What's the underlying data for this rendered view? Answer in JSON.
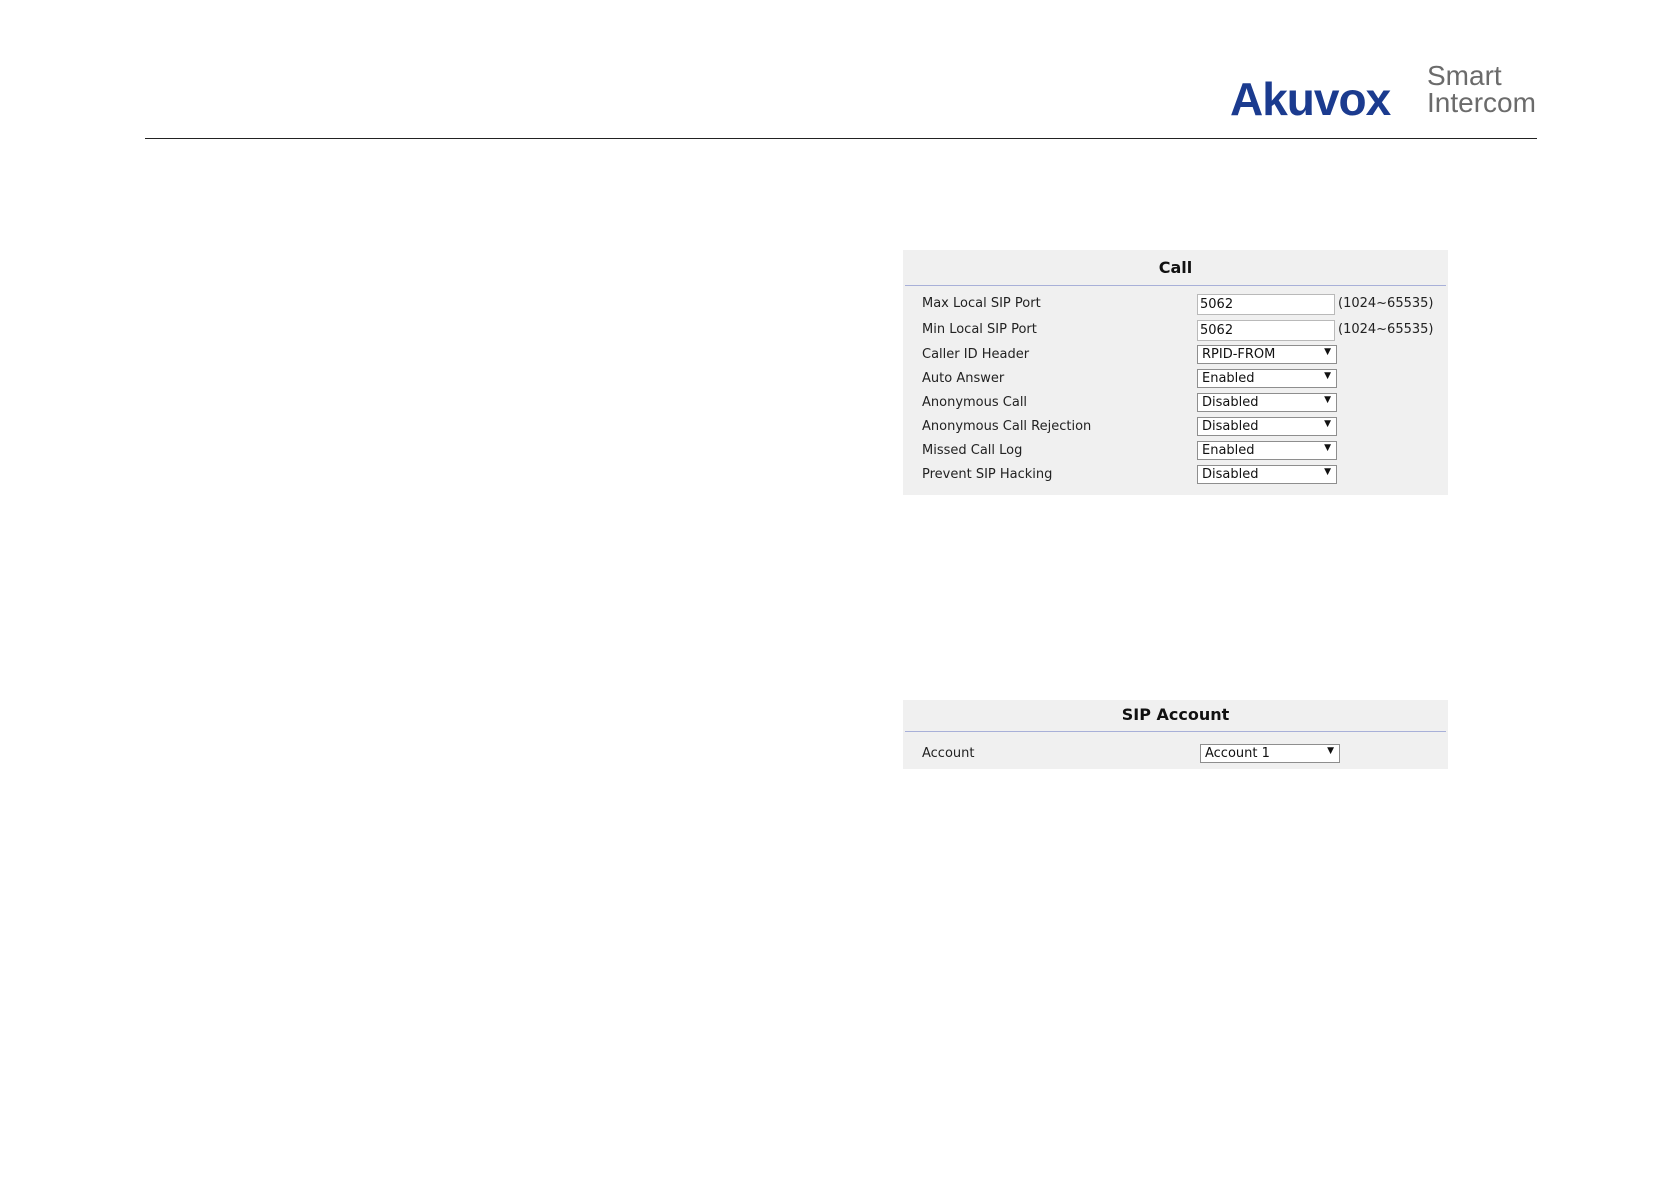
{
  "logo": {
    "brand": "Akuvox",
    "tagline_line1": "Smart",
    "tagline_line2": "Intercom"
  },
  "call_panel": {
    "title": "Call",
    "max_local_sip_port": {
      "label": "Max Local SIP Port",
      "value": "5062",
      "range": "(1024~65535)"
    },
    "min_local_sip_port": {
      "label": "Min Local SIP Port",
      "value": "5062",
      "range": "(1024~65535)"
    },
    "caller_id_header": {
      "label": "Caller ID Header",
      "value": "RPID-FROM"
    },
    "auto_answer": {
      "label": "Auto Answer",
      "value": "Enabled"
    },
    "anonymous_call": {
      "label": "Anonymous Call",
      "value": "Disabled"
    },
    "anonymous_call_rejection": {
      "label": "Anonymous Call Rejection",
      "value": "Disabled"
    },
    "missed_call_log": {
      "label": "Missed Call Log",
      "value": "Enabled"
    },
    "prevent_sip_hacking": {
      "label": "Prevent SIP Hacking",
      "value": "Disabled"
    }
  },
  "sip_panel": {
    "title": "SIP Account",
    "account": {
      "label": "Account",
      "value": "Account 1"
    }
  },
  "icons": {
    "dropdown_arrow": "▼"
  }
}
